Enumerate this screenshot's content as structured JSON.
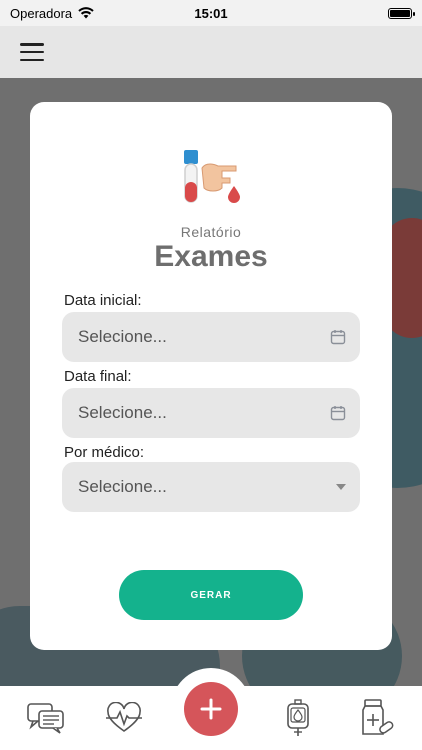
{
  "status_bar": {
    "carrier": "Operadora",
    "time": "15:01"
  },
  "header": {
    "menu_icon": "hamburger-menu-icon"
  },
  "card": {
    "subtitle": "Relatório",
    "title": "Exames",
    "illustration": "blood-test-tube-icon",
    "fields": {
      "start_date": {
        "label": "Data inicial:",
        "placeholder": "Selecione...",
        "icon": "calendar-icon"
      },
      "end_date": {
        "label": "Data final:",
        "placeholder": "Selecione...",
        "icon": "calendar-icon"
      },
      "doctor": {
        "label": "Por médico:",
        "placeholder": "Selecione...",
        "icon": "caret-down-icon"
      }
    },
    "submit_label": "GERAR",
    "submit_color": "#14b28d"
  },
  "tabbar": {
    "items": [
      {
        "icon": "chat-messages-icon"
      },
      {
        "icon": "heart-pulse-icon"
      },
      {
        "icon": "plus-icon",
        "color": "#d5555a"
      },
      {
        "icon": "blood-bag-icon"
      },
      {
        "icon": "medicine-bottle-icon"
      }
    ]
  }
}
